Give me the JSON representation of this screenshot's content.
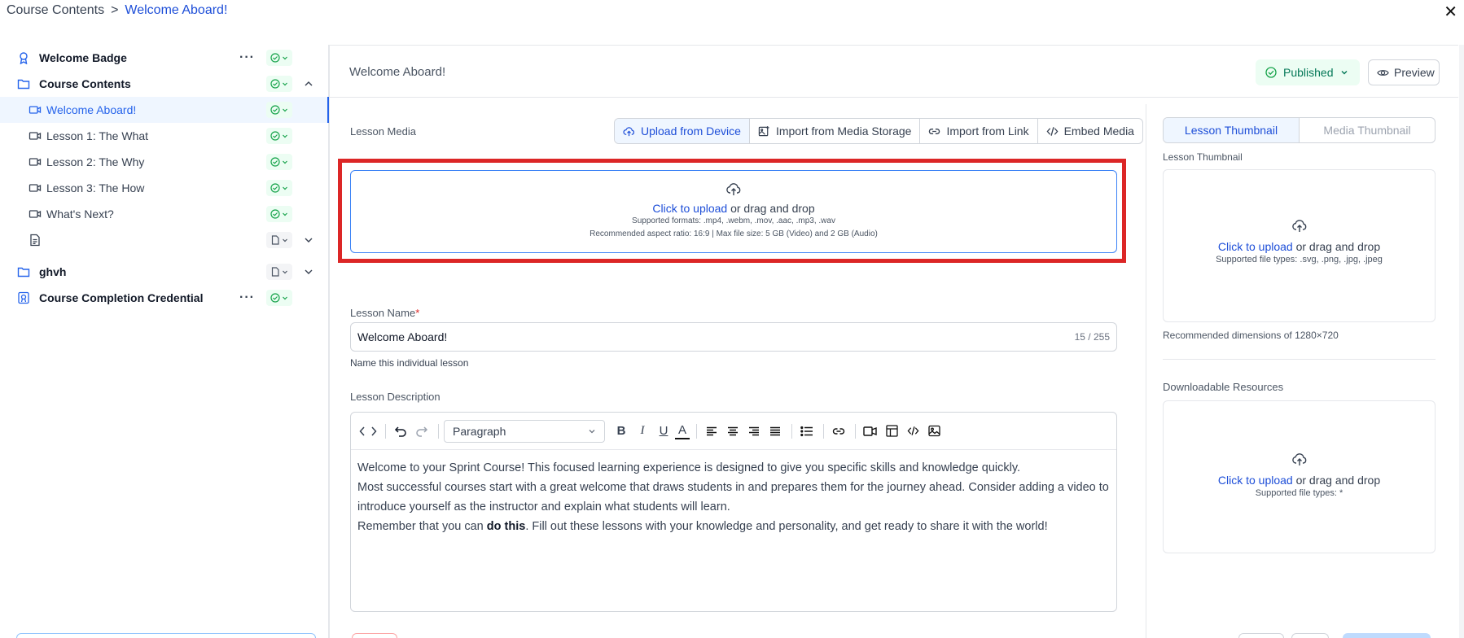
{
  "breadcrumb": {
    "parent": "Course Contents",
    "separator": ">",
    "current": "Welcome Aboard!"
  },
  "sidebar": {
    "items": [
      {
        "label": "Welcome Badge",
        "icon": "badge-icon",
        "kind": "bold",
        "status": "published",
        "menu": true
      },
      {
        "label": "Course Contents",
        "icon": "folder-icon",
        "kind": "bold",
        "status": "published",
        "expanded": true
      },
      {
        "label": "Welcome Aboard!",
        "icon": "video-icon",
        "kind": "active",
        "status": "published"
      },
      {
        "label": "Lesson 1: The What",
        "icon": "video-icon",
        "kind": "sub",
        "status": "published"
      },
      {
        "label": "Lesson 2: The Why",
        "icon": "video-icon",
        "kind": "sub",
        "status": "published"
      },
      {
        "label": "Lesson 3: The How",
        "icon": "video-icon",
        "kind": "sub",
        "status": "published"
      },
      {
        "label": "What's Next?",
        "icon": "video-icon",
        "kind": "sub",
        "status": "published"
      },
      {
        "label": "",
        "icon": "document-icon",
        "kind": "sub",
        "status": "draft",
        "collapsed": true
      },
      {
        "label": "ghvh",
        "icon": "folder-icon",
        "kind": "bold",
        "status": "draft",
        "collapsed": true
      },
      {
        "label": "Course Completion Credential",
        "icon": "certificate-icon",
        "kind": "bold",
        "status": "published",
        "menu": true
      }
    ]
  },
  "header": {
    "title": "Welcome Aboard!",
    "status_label": "Published",
    "preview_label": "Preview"
  },
  "media": {
    "section_label": "Lesson Media",
    "tabs": [
      "Upload from Device",
      "Import from Media Storage",
      "Import from Link",
      "Embed Media"
    ],
    "upload_link": "Click to upload",
    "upload_rest": "or drag and drop",
    "formats": "Supported formats: .mp4, .webm, .mov, .aac, .mp3, .wav",
    "limits": "Recommended aspect ratio: 16:9 | Max file size: 5 GB (Video) and 2 GB (Audio)"
  },
  "lesson_name": {
    "label": "Lesson Name",
    "required": "*",
    "value": "Welcome Aboard!",
    "counter": "15 / 255",
    "hint": "Name this individual lesson"
  },
  "description": {
    "label": "Lesson Description",
    "block_format": "Paragraph",
    "p1": "Welcome to your Sprint Course! This focused learning experience is designed to give you specific skills and knowledge quickly.",
    "p2": "Most successful courses start with a great welcome that draws students in and prepares them for the journey ahead. Consider adding a video to introduce yourself as the instructor and explain what students will learn.",
    "p3_before": "Remember that you can ",
    "p3_bold": "do this",
    "p3_after": ". Fill out these lessons with your knowledge and personality, and get ready to share it with the world!"
  },
  "thumbnail": {
    "tabs": [
      "Lesson Thumbnail",
      "Media Thumbnail"
    ],
    "label": "Lesson Thumbnail",
    "upload_link": "Click to upload",
    "upload_rest": "or drag and drop",
    "types": "Supported file types: .svg, .png, .jpg, .jpeg",
    "dimensions": "Recommended dimensions of 1280×720"
  },
  "resources": {
    "label": "Downloadable Resources",
    "upload_link": "Click to upload",
    "upload_rest": "or drag and drop",
    "types": "Supported file types: *"
  },
  "colors": {
    "accent": "#1d4ed8",
    "published_bg": "#ecfdf3",
    "published_text": "#047857",
    "highlight": "#dc2626"
  }
}
